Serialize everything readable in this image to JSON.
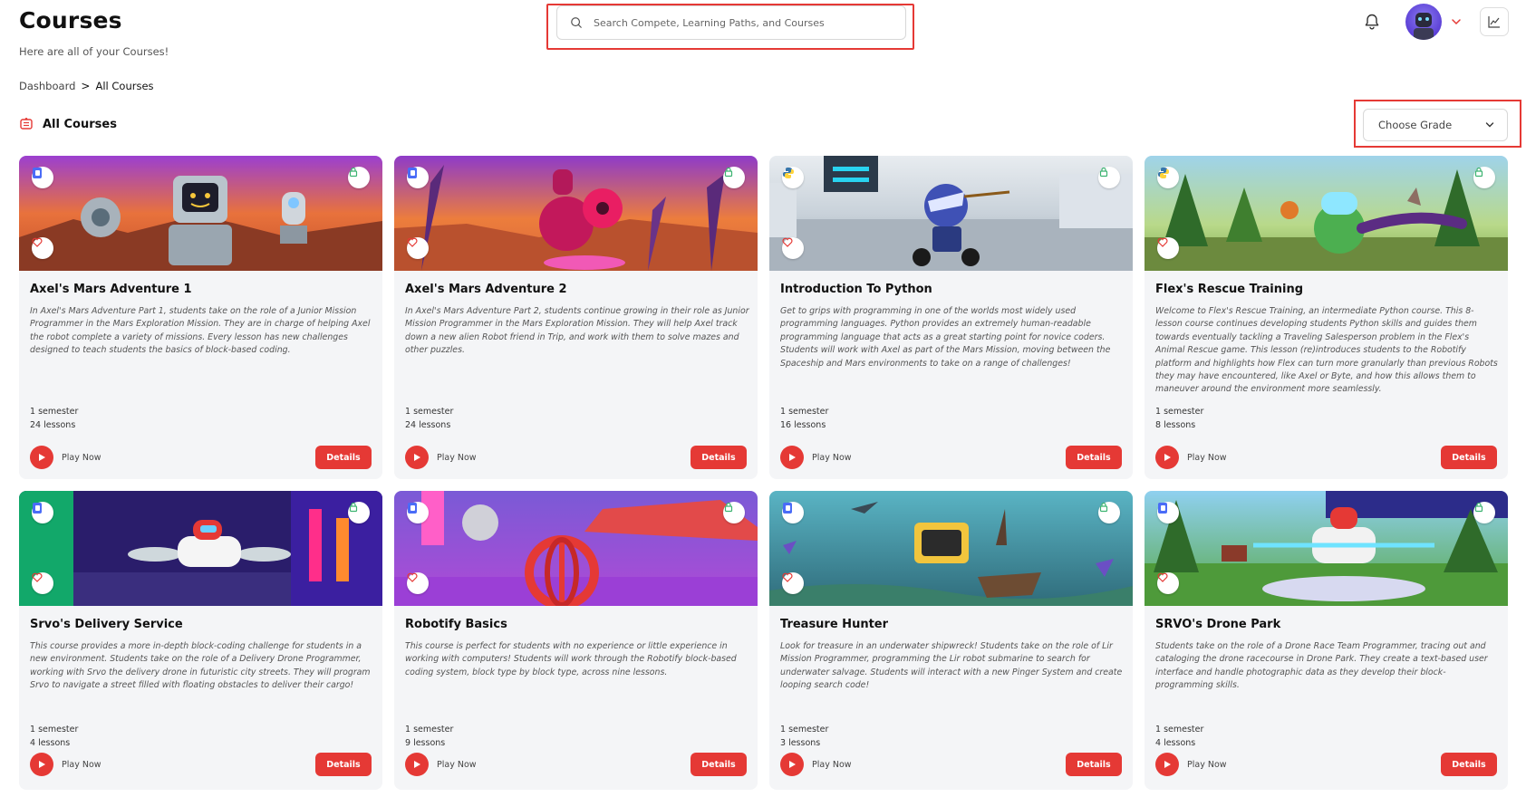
{
  "header": {
    "title": "Courses",
    "subtitle": "Here are all of your Courses!",
    "search_placeholder": "Search Compete, Learning Paths, and Courses"
  },
  "breadcrumb": {
    "root": "Dashboard",
    "separator": ">",
    "current": "All Courses"
  },
  "section": {
    "title": "All Courses"
  },
  "grade_select": {
    "selected": "Choose Grade"
  },
  "colors": {
    "accent": "#e53935",
    "card_bg": "#f4f5f7"
  },
  "courses": [
    {
      "title": "Axel's Mars Adventure 1",
      "description": "In Axel's Mars Adventure Part 1, students take on the role of a Junior Mission Programmer in the Mars Exploration Mission. They are in charge of helping Axel the robot complete a variety of missions. Every lesson has new challenges designed to teach students the basics of block-based coding.",
      "duration": "1 semester",
      "lessons": "24 lessons",
      "play_label": "Play Now",
      "details_label": "Details",
      "language_icon": "blocks-icon"
    },
    {
      "title": "Axel's Mars Adventure 2",
      "description": "In Axel's Mars Adventure Part 2, students continue growing in their role as Junior Mission Programmer in the Mars Exploration Mission. They will help Axel track down a new alien Robot friend in Trip, and work with them to solve mazes and other puzzles.",
      "duration": "1 semester",
      "lessons": "24 lessons",
      "play_label": "Play Now",
      "details_label": "Details",
      "language_icon": "blocks-icon"
    },
    {
      "title": "Introduction To Python",
      "description": "Get to grips with programming in one of the worlds most widely used programming languages. Python provides an extremely human-readable programming language that acts as a great starting point for novice coders. Students will work with Axel as part of the Mars Mission, moving between the Spaceship and Mars environments to take on a range of challenges!",
      "duration": "1 semester",
      "lessons": "16 lessons",
      "play_label": "Play Now",
      "details_label": "Details",
      "language_icon": "python-icon"
    },
    {
      "title": "Flex's Rescue Training",
      "description": "Welcome to Flex's Rescue Training, an intermediate Python course. This 8-lesson course continues developing students Python skills and guides them towards eventually tackling a Traveling Salesperson problem in the Flex's Animal Rescue game. This lesson (re)introduces students to the Robotify platform and highlights how Flex can turn more granularly than previous Robots they may have encountered, like Axel or Byte, and how this allows them to maneuver around the environment more seamlessly.",
      "duration": "1 semester",
      "lessons": "8 lessons",
      "play_label": "Play Now",
      "details_label": "Details",
      "language_icon": "python-icon"
    },
    {
      "title": "Srvo's Delivery Service",
      "description": "This course provides a more in-depth block-coding challenge for students in a new environment. Students take on the role of a Delivery Drone Programmer, working with Srvo the delivery drone in futuristic city streets. They will program Srvo to navigate a street filled with floating obstacles to deliver their cargo!",
      "duration": "1 semester",
      "lessons": "4 lessons",
      "play_label": "Play Now",
      "details_label": "Details",
      "language_icon": "blocks-icon"
    },
    {
      "title": "Robotify Basics",
      "description": "This course is perfect for students with no experience or little experience in working with computers! Students will work through the Robotify block-based coding system, block type by block type, across nine lessons.",
      "duration": "1 semester",
      "lessons": "9 lessons",
      "play_label": "Play Now",
      "details_label": "Details",
      "language_icon": "blocks-icon"
    },
    {
      "title": "Treasure Hunter",
      "description": "Look for treasure in an underwater shipwreck! Students take on the role of Lir Mission Programmer, programming the Lir robot submarine to search for underwater salvage. Students will interact with a new Pinger System and create looping search code!",
      "duration": "1 semester",
      "lessons": "3 lessons",
      "play_label": "Play Now",
      "details_label": "Details",
      "language_icon": "blocks-icon"
    },
    {
      "title": "SRVO's Drone Park",
      "description": "Students take on the role of a Drone Race Team Programmer, tracing out and cataloging the drone racecourse in Drone Park. They create a text-based user interface and handle photographic data as they develop their block-programming skills.",
      "duration": "1 semester",
      "lessons": "4 lessons",
      "play_label": "Play Now",
      "details_label": "Details",
      "language_icon": "blocks-icon"
    }
  ]
}
